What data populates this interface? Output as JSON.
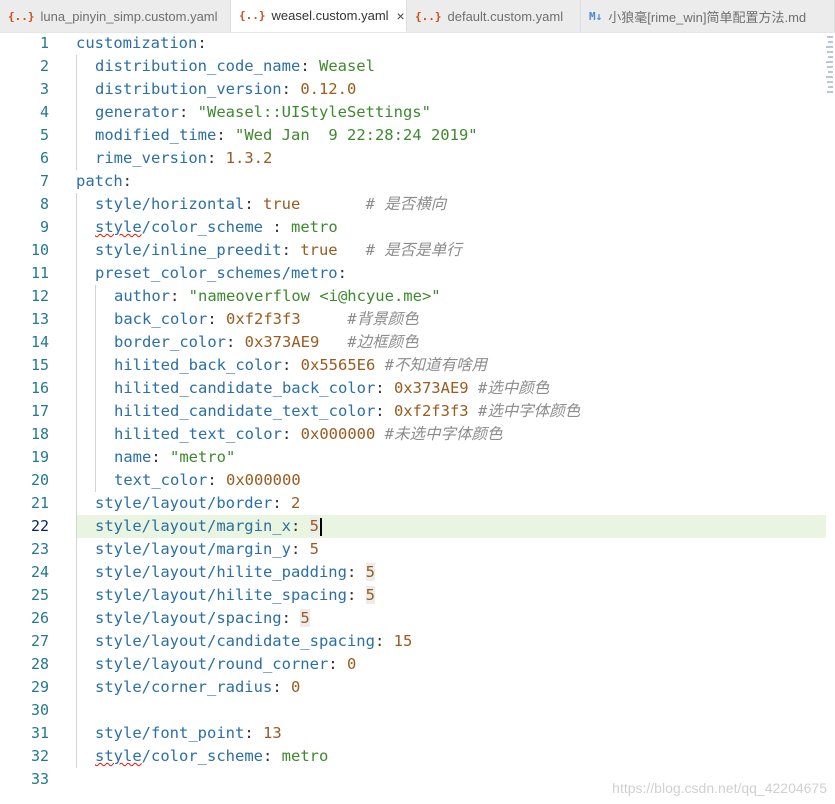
{
  "tabs": [
    {
      "icon": "{..}",
      "icon_color": "#d04a12",
      "label": "luna_pinyin_simp.custom.yaml",
      "active": false
    },
    {
      "icon": "{..}",
      "icon_color": "#d04a12",
      "label": "weasel.custom.yaml",
      "active": true,
      "close": "×"
    },
    {
      "icon": "{..}",
      "icon_color": "#d04a12",
      "label": "default.custom.yaml",
      "active": false
    },
    {
      "icon": "M↓",
      "icon_color": "#4a8bd6",
      "label": "小狼毫[rime_win]简单配置方法.md",
      "active": false
    }
  ],
  "current_line": 22,
  "lines": [
    {
      "n": "1",
      "indent": 0,
      "parts": [
        {
          "t": "customization",
          "c": "k"
        },
        {
          "t": ":",
          "c": "p"
        }
      ]
    },
    {
      "n": "2",
      "indent": 1,
      "parts": [
        {
          "t": "distribution_code_name",
          "c": "k"
        },
        {
          "t": ": ",
          "c": "p"
        },
        {
          "t": "Weasel",
          "c": "s"
        }
      ]
    },
    {
      "n": "3",
      "indent": 1,
      "parts": [
        {
          "t": "distribution_version",
          "c": "k"
        },
        {
          "t": ": ",
          "c": "p"
        },
        {
          "t": "0.12.0",
          "c": "n"
        }
      ]
    },
    {
      "n": "4",
      "indent": 1,
      "parts": [
        {
          "t": "generator",
          "c": "k"
        },
        {
          "t": ": ",
          "c": "p"
        },
        {
          "t": "\"Weasel::UIStyleSettings\"",
          "c": "s"
        }
      ]
    },
    {
      "n": "5",
      "indent": 1,
      "parts": [
        {
          "t": "modified_time",
          "c": "k"
        },
        {
          "t": ": ",
          "c": "p"
        },
        {
          "t": "\"Wed Jan  9 22:28:24 2019\"",
          "c": "s"
        }
      ]
    },
    {
      "n": "6",
      "indent": 1,
      "parts": [
        {
          "t": "rime_version",
          "c": "k"
        },
        {
          "t": ": ",
          "c": "p"
        },
        {
          "t": "1.3.2",
          "c": "n"
        }
      ]
    },
    {
      "n": "7",
      "indent": 0,
      "parts": [
        {
          "t": "patch",
          "c": "k"
        },
        {
          "t": ":",
          "c": "p"
        }
      ]
    },
    {
      "n": "8",
      "indent": 1,
      "parts": [
        {
          "t": "style/horizontal",
          "c": "k"
        },
        {
          "t": ": ",
          "c": "p"
        },
        {
          "t": "true",
          "c": "n"
        },
        {
          "t": "       ",
          "c": "p"
        },
        {
          "t": "# 是否横向",
          "c": "c"
        }
      ]
    },
    {
      "n": "9",
      "indent": 1,
      "parts": [
        {
          "t": "style",
          "c": "k sq"
        },
        {
          "t": "/color_scheme",
          "c": "k"
        },
        {
          "t": " : ",
          "c": "p"
        },
        {
          "t": "metro",
          "c": "s"
        }
      ]
    },
    {
      "n": "10",
      "indent": 1,
      "parts": [
        {
          "t": "style/inline_preedit",
          "c": "k"
        },
        {
          "t": ": ",
          "c": "p"
        },
        {
          "t": "true",
          "c": "n"
        },
        {
          "t": "   ",
          "c": "p"
        },
        {
          "t": "# 是否是单行",
          "c": "c"
        }
      ]
    },
    {
      "n": "11",
      "indent": 1,
      "parts": [
        {
          "t": "preset_color_schemes/metro",
          "c": "k"
        },
        {
          "t": ":",
          "c": "p"
        }
      ]
    },
    {
      "n": "12",
      "indent": 2,
      "parts": [
        {
          "t": "author",
          "c": "k"
        },
        {
          "t": ": ",
          "c": "p"
        },
        {
          "t": "\"nameoverflow <i@hcyue.me>\"",
          "c": "s"
        }
      ]
    },
    {
      "n": "13",
      "indent": 2,
      "parts": [
        {
          "t": "back_color",
          "c": "k"
        },
        {
          "t": ": ",
          "c": "p"
        },
        {
          "t": "0xf2f3f3",
          "c": "n"
        },
        {
          "t": "     ",
          "c": "p"
        },
        {
          "t": "#背景颜色",
          "c": "c"
        }
      ]
    },
    {
      "n": "14",
      "indent": 2,
      "parts": [
        {
          "t": "border_color",
          "c": "k"
        },
        {
          "t": ": ",
          "c": "p"
        },
        {
          "t": "0x373AE9",
          "c": "n"
        },
        {
          "t": "   ",
          "c": "p"
        },
        {
          "t": "#边框颜色",
          "c": "c"
        }
      ]
    },
    {
      "n": "15",
      "indent": 2,
      "parts": [
        {
          "t": "hilited_back_color",
          "c": "k"
        },
        {
          "t": ": ",
          "c": "p"
        },
        {
          "t": "0x5565E6",
          "c": "n"
        },
        {
          "t": " ",
          "c": "p"
        },
        {
          "t": "#不知道有啥用",
          "c": "c"
        }
      ]
    },
    {
      "n": "16",
      "indent": 2,
      "parts": [
        {
          "t": "hilited_candidate_back_color",
          "c": "k"
        },
        {
          "t": ": ",
          "c": "p"
        },
        {
          "t": "0x373AE9",
          "c": "n"
        },
        {
          "t": " ",
          "c": "p"
        },
        {
          "t": "#选中颜色",
          "c": "c"
        }
      ]
    },
    {
      "n": "17",
      "indent": 2,
      "parts": [
        {
          "t": "hilited_candidate_text_color",
          "c": "k"
        },
        {
          "t": ": ",
          "c": "p"
        },
        {
          "t": "0xf2f3f3",
          "c": "n"
        },
        {
          "t": " ",
          "c": "p"
        },
        {
          "t": "#选中字体颜色",
          "c": "c"
        }
      ]
    },
    {
      "n": "18",
      "indent": 2,
      "parts": [
        {
          "t": "hilited_text_color",
          "c": "k"
        },
        {
          "t": ": ",
          "c": "p"
        },
        {
          "t": "0x000000",
          "c": "n"
        },
        {
          "t": " ",
          "c": "p"
        },
        {
          "t": "#未选中字体颜色",
          "c": "c"
        }
      ]
    },
    {
      "n": "19",
      "indent": 2,
      "parts": [
        {
          "t": "name",
          "c": "k"
        },
        {
          "t": ": ",
          "c": "p"
        },
        {
          "t": "\"metro\"",
          "c": "s"
        }
      ]
    },
    {
      "n": "20",
      "indent": 2,
      "parts": [
        {
          "t": "text_color",
          "c": "k"
        },
        {
          "t": ": ",
          "c": "p"
        },
        {
          "t": "0x000000",
          "c": "n"
        }
      ]
    },
    {
      "n": "21",
      "indent": 1,
      "parts": [
        {
          "t": "style/layout/border",
          "c": "k"
        },
        {
          "t": ": ",
          "c": "p"
        },
        {
          "t": "2",
          "c": "n"
        }
      ]
    },
    {
      "n": "22",
      "indent": 1,
      "parts": [
        {
          "t": "style/layout/margin_x",
          "c": "k"
        },
        {
          "t": ": ",
          "c": "p"
        },
        {
          "t": "5",
          "c": "n hlnum"
        }
      ],
      "cursor": true
    },
    {
      "n": "23",
      "indent": 1,
      "parts": [
        {
          "t": "style/layout/margin_y",
          "c": "k"
        },
        {
          "t": ": ",
          "c": "p"
        },
        {
          "t": "5",
          "c": "n"
        }
      ]
    },
    {
      "n": "24",
      "indent": 1,
      "parts": [
        {
          "t": "style/layout/hilite_padding",
          "c": "k"
        },
        {
          "t": ": ",
          "c": "p"
        },
        {
          "t": "5",
          "c": "n hlnum"
        }
      ]
    },
    {
      "n": "25",
      "indent": 1,
      "parts": [
        {
          "t": "style/layout/hilite_spacing",
          "c": "k"
        },
        {
          "t": ": ",
          "c": "p"
        },
        {
          "t": "5",
          "c": "n hlnum"
        }
      ]
    },
    {
      "n": "26",
      "indent": 1,
      "parts": [
        {
          "t": "style/layout/spacing",
          "c": "k"
        },
        {
          "t": ": ",
          "c": "p"
        },
        {
          "t": "5",
          "c": "n hlnum"
        }
      ]
    },
    {
      "n": "27",
      "indent": 1,
      "parts": [
        {
          "t": "style/layout/candidate_spacing",
          "c": "k"
        },
        {
          "t": ": ",
          "c": "p"
        },
        {
          "t": "15",
          "c": "n"
        }
      ]
    },
    {
      "n": "28",
      "indent": 1,
      "parts": [
        {
          "t": "style/layout/round_corner",
          "c": "k"
        },
        {
          "t": ": ",
          "c": "p"
        },
        {
          "t": "0",
          "c": "n"
        }
      ]
    },
    {
      "n": "29",
      "indent": 1,
      "parts": [
        {
          "t": "style/corner_radius",
          "c": "k"
        },
        {
          "t": ": ",
          "c": "p"
        },
        {
          "t": "0",
          "c": "n"
        }
      ]
    },
    {
      "n": "30",
      "indent": 1,
      "parts": []
    },
    {
      "n": "31",
      "indent": 1,
      "parts": [
        {
          "t": "style/font_point",
          "c": "k"
        },
        {
          "t": ": ",
          "c": "p"
        },
        {
          "t": "13",
          "c": "n"
        }
      ]
    },
    {
      "n": "32",
      "indent": 1,
      "parts": [
        {
          "t": "style",
          "c": "k sq"
        },
        {
          "t": "/color_scheme",
          "c": "k"
        },
        {
          "t": ": ",
          "c": "p"
        },
        {
          "t": "metro",
          "c": "s"
        }
      ]
    },
    {
      "n": "33",
      "indent": 0,
      "parts": []
    }
  ],
  "watermark": "https://blog.csdn.net/qq_42204675"
}
